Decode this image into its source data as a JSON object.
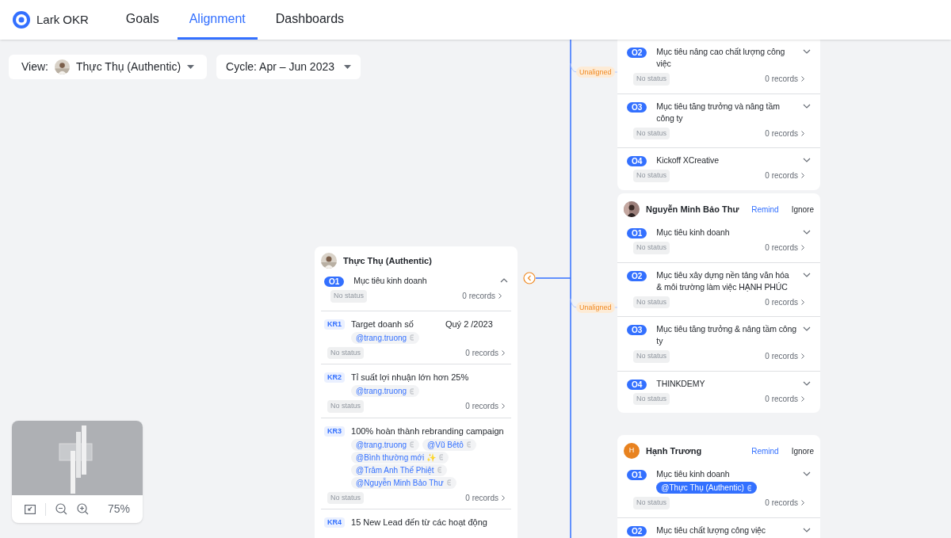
{
  "app": {
    "name": "Lark OKR"
  },
  "tabs": [
    {
      "label": "Goals",
      "selected": false
    },
    {
      "label": "Alignment",
      "selected": true
    },
    {
      "label": "Dashboards",
      "selected": false
    }
  ],
  "filters": {
    "view_label": "View:",
    "view_value": "Thực Thụ (Authentic)",
    "cycle": "Cycle: Apr – Jun 2023"
  },
  "center_card": {
    "owner": "Thực Thụ (Authentic)",
    "objectives": [
      {
        "code": "O1",
        "title": "Mục tiêu kinh doanh",
        "status": "No status",
        "records": "0 records",
        "expanded": true,
        "key_results": [
          {
            "code": "KR1",
            "title": "Target doanh số",
            "note": "Quý 2 /2023",
            "mentions": [
              {
                "text": "@trang.truong",
                "highlighted": false
              }
            ],
            "status": "No status",
            "records": "0 records"
          },
          {
            "code": "KR2",
            "title": "Tỉ suất lợi nhuận lớn hơn 25%",
            "mentions": [
              {
                "text": "@trang.truong",
                "highlighted": false
              }
            ],
            "status": "No status",
            "records": "0 records"
          },
          {
            "code": "KR3",
            "title": "100% hoàn thành rebranding campaign",
            "mentions": [
              {
                "text": "@trang.truong",
                "highlighted": false
              },
              {
                "text": "@Vũ Bêtô",
                "highlighted": false
              },
              {
                "text": "@Bình thường mới ✨",
                "highlighted": false
              },
              {
                "text": "@Trâm Anh Thế Phiệt",
                "highlighted": false
              },
              {
                "text": "@Nguyễn Minh Bảo Thư",
                "highlighted": false
              }
            ],
            "status": "No status",
            "records": "0 records"
          },
          {
            "code": "KR4",
            "title": "15 New Lead đến từ các hoạt động"
          }
        ]
      }
    ]
  },
  "collapse_button": {
    "expanded": true
  },
  "right_cards": [
    {
      "branch_label": "Unaligned",
      "objectives": [
        {
          "code": "O2",
          "title": "Mục tiêu nâng cao chất lượng công việc",
          "status": "No status",
          "records": "0 records",
          "expanded": false
        },
        {
          "code": "O3",
          "title": "Mục tiêu tăng trưởng và nâng tầm công ty",
          "status": "No status",
          "records": "0 records",
          "expanded": false
        },
        {
          "code": "O4",
          "title": "Kickoff XCreative",
          "status": "No status",
          "records": "0 records",
          "expanded": false
        }
      ]
    },
    {
      "owner": "Nguyễn Minh Bảo Thư",
      "avatar": {
        "kind": "picture"
      },
      "remind": "Remind",
      "ignore": "Ignore",
      "branch_label": "Unaligned",
      "objectives": [
        {
          "code": "O1",
          "title": "Mục tiêu kinh doanh",
          "status": "No status",
          "records": "0 records",
          "expanded": false
        },
        {
          "code": "O2",
          "title": "Mục tiêu xây dựng nền tảng văn hóa & môi trường làm việc HẠNH PHÚC",
          "status": "No status",
          "records": "0 records",
          "expanded": false
        },
        {
          "code": "O3",
          "title": "Mục tiêu tăng trưởng & nâng tầm công ty",
          "status": "No status",
          "records": "0 records",
          "expanded": false
        },
        {
          "code": "O4",
          "title": "THINKDEMY",
          "status": "No status",
          "records": "0 records",
          "expanded": false
        }
      ]
    },
    {
      "owner": "Hạnh Trương",
      "avatar": {
        "kind": "initial",
        "initial": "H",
        "color": "#e8821f"
      },
      "remind": "Remind",
      "ignore": "Ignore",
      "objectives": [
        {
          "code": "O1",
          "title": "Mục tiêu kinh doanh",
          "mentions": [
            {
              "text": "@Thực Thụ (Authentic)",
              "highlighted": true
            }
          ],
          "status": "No status",
          "records": "0 records",
          "expanded": false
        },
        {
          "code": "O2",
          "title": "Mục tiêu chất lượng công việc",
          "expanded": false
        }
      ]
    }
  ],
  "minimap": {
    "zoom": "75%"
  }
}
